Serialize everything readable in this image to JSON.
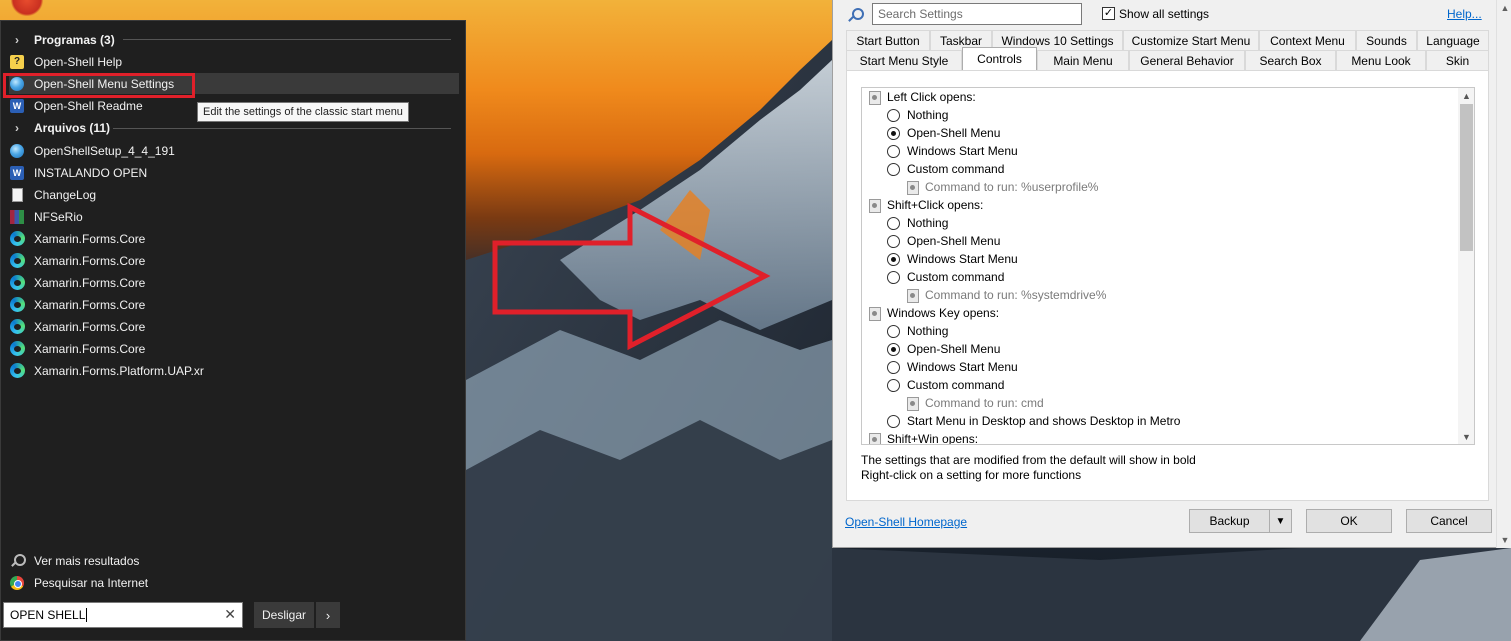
{
  "start_menu": {
    "groups": [
      {
        "label": "Programas (3)"
      },
      {
        "label": "Arquivos (11)"
      }
    ],
    "programs": [
      {
        "label": "Open-Shell Help",
        "icon": "help-icon"
      },
      {
        "label": "Open-Shell Menu Settings",
        "icon": "open-shell-icon"
      },
      {
        "label": "Open-Shell Readme",
        "icon": "word-icon"
      }
    ],
    "files": [
      {
        "label": "OpenShellSetup_4_4_191",
        "icon": "open-shell-icon"
      },
      {
        "label": "INSTALANDO OPEN",
        "icon": "word-icon"
      },
      {
        "label": "ChangeLog",
        "icon": "document-icon"
      },
      {
        "label": "NFSeRio",
        "icon": "archive-icon"
      },
      {
        "label": "Xamarin.Forms.Core",
        "icon": "edge-icon"
      },
      {
        "label": "Xamarin.Forms.Core",
        "icon": "edge-icon"
      },
      {
        "label": "Xamarin.Forms.Core",
        "icon": "edge-icon"
      },
      {
        "label": "Xamarin.Forms.Core",
        "icon": "edge-icon"
      },
      {
        "label": "Xamarin.Forms.Core",
        "icon": "edge-icon"
      },
      {
        "label": "Xamarin.Forms.Core",
        "icon": "edge-icon"
      },
      {
        "label": "Xamarin.Forms.Platform.UAP.xr",
        "icon": "edge-icon"
      }
    ],
    "tooltip": "Edit the settings of the classic start menu",
    "more_results": "Ver mais resultados",
    "search_internet": "Pesquisar na Internet",
    "search_value": "OPEN SHELL",
    "shutdown_label": "Desligar",
    "shutdown_arrow": "›",
    "clear_glyph": "✕",
    "highlight_color": "#e0202a"
  },
  "settings": {
    "search_placeholder": "Search Settings",
    "show_all_label": "Show all settings",
    "show_all_checked": true,
    "help_label": "Help...",
    "tabs_row1": [
      "Start Button",
      "Taskbar",
      "Windows 10 Settings",
      "Customize Start Menu",
      "Context Menu",
      "Sounds",
      "Language"
    ],
    "tabs_row2": [
      "Start Menu Style",
      "Controls",
      "Main Menu",
      "General Behavior",
      "Search Box",
      "Menu Look",
      "Skin"
    ],
    "active_tab": "Controls",
    "tree": {
      "left_click": {
        "title": "Left Click opens:",
        "options": [
          "Nothing",
          "Open-Shell Menu",
          "Windows Start Menu",
          "Custom command"
        ],
        "selected": "Open-Shell Menu",
        "command": "Command to run: %userprofile%"
      },
      "shift_click": {
        "title": "Shift+Click opens:",
        "options": [
          "Nothing",
          "Open-Shell Menu",
          "Windows Start Menu",
          "Custom command"
        ],
        "selected": "Windows Start Menu",
        "command": "Command to run: %systemdrive%"
      },
      "win_key": {
        "title": "Windows Key opens:",
        "options": [
          "Nothing",
          "Open-Shell Menu",
          "Windows Start Menu",
          "Custom command"
        ],
        "selected": "Open-Shell Menu",
        "command": "Command to run: cmd",
        "extra": "Start Menu in Desktop and shows Desktop in Metro"
      },
      "shift_win": {
        "title": "Shift+Win opens:"
      }
    },
    "hint1": "The settings that are modified from the default will show in bold",
    "hint2": "Right-click on a setting for more functions",
    "homepage": "Open-Shell Homepage",
    "backup_label": "Backup",
    "ok_label": "OK",
    "cancel_label": "Cancel"
  }
}
